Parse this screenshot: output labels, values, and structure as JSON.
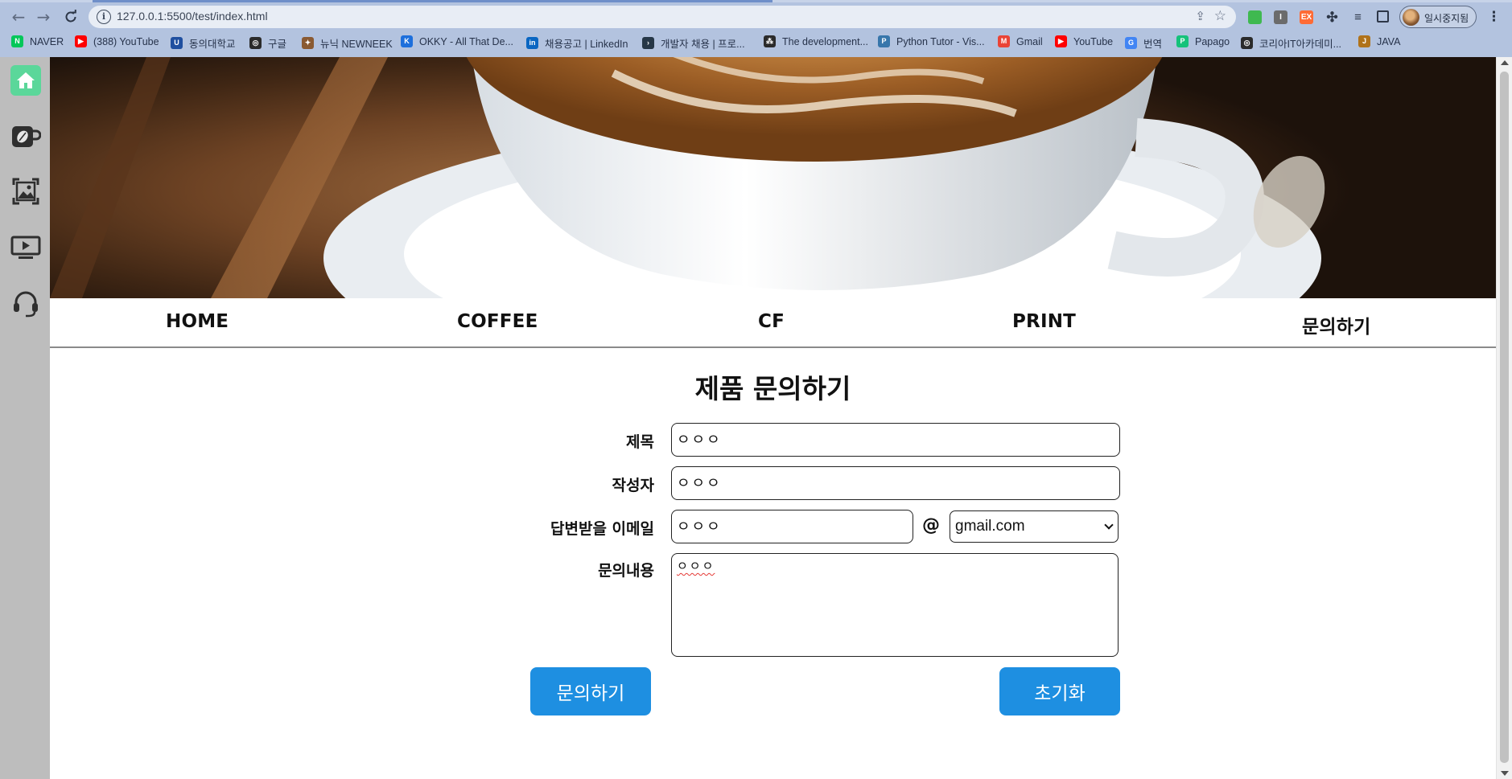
{
  "browser": {
    "url": "127.0.0.1:5500/test/index.html",
    "profile_label": "일시중지됨",
    "extensions": [
      {
        "name": "green-ext-icon",
        "label": "",
        "color": "#3fb950"
      },
      {
        "name": "gray-ext-icon",
        "label": "I",
        "color": "#6b6b6b"
      },
      {
        "name": "ex-ext-icon",
        "label": "EX",
        "color": "#ff6b35"
      }
    ],
    "bookmarks": [
      {
        "label": "NAVER",
        "icon": "naver-icon",
        "color": "#03c75a",
        "glyph": "N"
      },
      {
        "label": "(388) YouTube",
        "icon": "youtube-icon",
        "color": "#ff0000",
        "glyph": "▶"
      },
      {
        "label": "동의대학교",
        "icon": "university-icon",
        "color": "#1f4fa0",
        "glyph": "U"
      },
      {
        "label": "구글",
        "icon": "globe-icon",
        "color": "#2b2b2b",
        "glyph": "◎"
      },
      {
        "label": "뉴닉 NEWNEEK",
        "icon": "hedgehog-icon",
        "color": "#8a5a32",
        "glyph": "✦"
      },
      {
        "label": "OKKY - All That De...",
        "icon": "okky-icon",
        "color": "#1d6fdc",
        "glyph": "K"
      },
      {
        "label": "채용공고 | LinkedIn",
        "icon": "linkedin-icon",
        "color": "#0a66c2",
        "glyph": "in"
      },
      {
        "label": "개발자 채용 | 프로...",
        "icon": "programmers-icon",
        "color": "#263747",
        "glyph": "›"
      },
      {
        "label": "The development...",
        "icon": "dev-icon",
        "color": "#2b2b2b",
        "glyph": "⁂"
      },
      {
        "label": "Python Tutor - Vis...",
        "icon": "python-icon",
        "color": "#3776ab",
        "glyph": "P"
      },
      {
        "label": "Gmail",
        "icon": "gmail-icon",
        "color": "#ea4335",
        "glyph": "M"
      },
      {
        "label": "YouTube",
        "icon": "youtube-icon",
        "color": "#ff0000",
        "glyph": "▶"
      },
      {
        "label": "번역",
        "icon": "translate-icon",
        "color": "#4285f4",
        "glyph": "G"
      },
      {
        "label": "Papago",
        "icon": "papago-icon",
        "color": "#16c27a",
        "glyph": "P"
      },
      {
        "label": "코리아IT아카데미...",
        "icon": "globe-icon",
        "color": "#2b2b2b",
        "glyph": "◎"
      },
      {
        "label": "JAVA",
        "icon": "java-icon",
        "color": "#b07219",
        "glyph": "J"
      }
    ]
  },
  "nav": {
    "home": "HOME",
    "coffee": "COFFEE",
    "cf": "CF",
    "print": "PRINT",
    "inquiry": "문의하기"
  },
  "form": {
    "title": "제품 문의하기",
    "subject_label": "제목",
    "subject_value": "ㅇㅇㅇ",
    "author_label": "작성자",
    "author_value": "ㅇㅇㅇ",
    "email_label": "답변받을 이메일",
    "email_value": "ㅇㅇㅇ",
    "at_sign": "@",
    "email_domain": "gmail.com",
    "content_label": "문의내용",
    "content_value": "ㅇㅇㅇ",
    "submit_label": "문의하기",
    "reset_label": "초기화"
  },
  "colors": {
    "button": "#1e8fe1",
    "sidebar": "#bdbdbd",
    "home_icon_active": "#5bd79a"
  }
}
